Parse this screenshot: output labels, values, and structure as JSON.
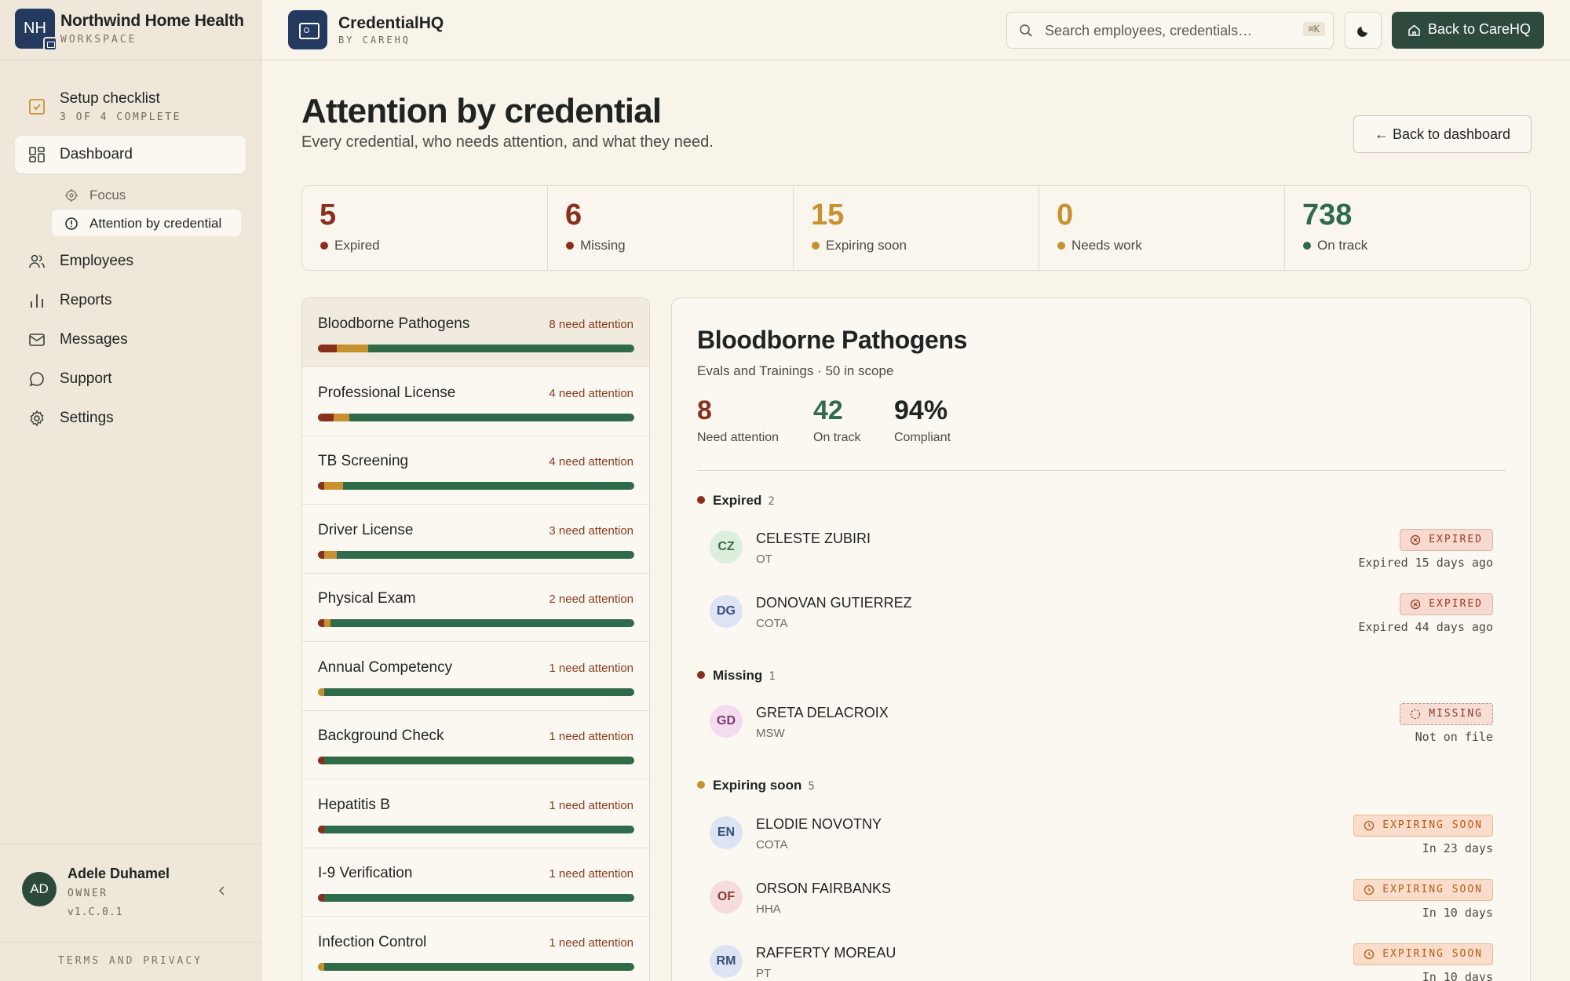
{
  "workspace": {
    "initials": "NH",
    "name": "Northwind Home Health",
    "sub": "WORKSPACE"
  },
  "sidebar": {
    "setup": {
      "title": "Setup checklist",
      "progress": "3 OF 4 COMPLETE"
    },
    "items": [
      {
        "label": "Dashboard",
        "icon": "grid-icon"
      },
      {
        "label": "Employees",
        "icon": "users-icon"
      },
      {
        "label": "Reports",
        "icon": "bar-chart-icon"
      },
      {
        "label": "Messages",
        "icon": "mail-icon"
      },
      {
        "label": "Support",
        "icon": "chat-icon"
      },
      {
        "label": "Settings",
        "icon": "gear-icon"
      }
    ],
    "subitems": [
      {
        "label": "Focus",
        "icon": "target-icon"
      },
      {
        "label": "Attention by credential",
        "icon": "alert-circle-icon"
      }
    ]
  },
  "user": {
    "initials": "AD",
    "name": "Adele Duhamel",
    "role": "OWNER",
    "version": "v1.C.0.1"
  },
  "footer": {
    "terms": "TERMS AND PRIVACY"
  },
  "app": {
    "name": "CredentialHQ",
    "sub": "BY CAREHQ"
  },
  "search": {
    "placeholder": "Search employees, credentials…",
    "shortcut": "⌘K"
  },
  "topbar": {
    "back_label": "Back to CareHQ"
  },
  "page": {
    "title": "Attention by credential",
    "subtitle": "Every credential, who needs attention, and what they need.",
    "back_label": "← Back to dashboard"
  },
  "stats": [
    {
      "value": "5",
      "label": "Expired",
      "color": "#8a2f1d",
      "dot": "#8a2f1d"
    },
    {
      "value": "6",
      "label": "Missing",
      "color": "#8a2f1d",
      "dot": "#8a2f1d"
    },
    {
      "value": "15",
      "label": "Expiring soon",
      "color": "#c79130",
      "dot": "#c79130"
    },
    {
      "value": "0",
      "label": "Needs work",
      "color": "#c79130",
      "dot": "#c79130"
    },
    {
      "value": "738",
      "label": "On track",
      "color": "#2f6b4a",
      "dot": "#2f6b4a"
    }
  ],
  "colors": {
    "expired": "#8a2f1d",
    "expiring": "#c79130",
    "ontrack": "#2f6b4a"
  },
  "credentials": [
    {
      "name": "Bloodborne Pathogens",
      "attention": "8 need attention",
      "bad": 0.06,
      "warn": 0.1
    },
    {
      "name": "Professional License",
      "attention": "4 need attention",
      "bad": 0.05,
      "warn": 0.05
    },
    {
      "name": "TB Screening",
      "attention": "4 need attention",
      "bad": 0.02,
      "warn": 0.06
    },
    {
      "name": "Driver License",
      "attention": "3 need attention",
      "bad": 0.02,
      "warn": 0.04
    },
    {
      "name": "Physical Exam",
      "attention": "2 need attention",
      "bad": 0.02,
      "warn": 0.02
    },
    {
      "name": "Annual Competency",
      "attention": "1 need attention",
      "bad": 0.0,
      "warn": 0.02
    },
    {
      "name": "Background Check",
      "attention": "1 need attention",
      "bad": 0.02,
      "warn": 0.0
    },
    {
      "name": "Hepatitis B",
      "attention": "1 need attention",
      "bad": 0.02,
      "warn": 0.0
    },
    {
      "name": "I-9 Verification",
      "attention": "1 need attention",
      "bad": 0.02,
      "warn": 0.0
    },
    {
      "name": "Infection Control",
      "attention": "1 need attention",
      "bad": 0.0,
      "warn": 0.02
    }
  ],
  "detail": {
    "title": "Bloodborne Pathogens",
    "subtitle": "Evals and Trainings · 50 in scope",
    "metrics": [
      {
        "value": "8",
        "label": "Need attention",
        "color": "#8a2f1d"
      },
      {
        "value": "42",
        "label": "On track",
        "color": "#2f6b4a"
      },
      {
        "value": "94%",
        "label": "Compliant",
        "color": "#1f2321"
      }
    ],
    "groups": [
      {
        "label": "Expired",
        "count": "2",
        "dot": "#8a2f1d"
      },
      {
        "label": "Missing",
        "count": "1",
        "dot": "#8a2f1d"
      },
      {
        "label": "Expiring soon",
        "count": "5",
        "dot": "#c79130"
      }
    ],
    "employees": [
      {
        "initials": "CZ",
        "name": "CELESTE ZUBIRI",
        "role": "OT",
        "badge": "EXPIRED",
        "when": "Expired 15 days ago",
        "av_bg": "#dcefdc",
        "av_fg": "#3b6b45"
      },
      {
        "initials": "DG",
        "name": "DONOVAN GUTIERREZ",
        "role": "COTA",
        "badge": "EXPIRED",
        "when": "Expired 44 days ago",
        "av_bg": "#dce3f2",
        "av_fg": "#3a4d7a"
      },
      {
        "initials": "GD",
        "name": "GRETA DELACROIX",
        "role": "MSW",
        "badge": "MISSING",
        "when": "Not on file",
        "av_bg": "#f3dcef",
        "av_fg": "#7a3a6c"
      },
      {
        "initials": "EN",
        "name": "ELODIE NOVOTNY",
        "role": "COTA",
        "badge": "EXPIRING SOON",
        "when": "In 23 days",
        "av_bg": "#dce3f2",
        "av_fg": "#3a4d7a"
      },
      {
        "initials": "OF",
        "name": "ORSON FAIRBANKS",
        "role": "HHA",
        "badge": "EXPIRING SOON",
        "when": "In 10 days",
        "av_bg": "#f6dcdc",
        "av_fg": "#8a3a3a"
      },
      {
        "initials": "RM",
        "name": "RAFFERTY MOREAU",
        "role": "PT",
        "badge": "EXPIRING SOON",
        "when": "In 10 days",
        "av_bg": "#dce3f2",
        "av_fg": "#3a4d7a"
      }
    ]
  }
}
